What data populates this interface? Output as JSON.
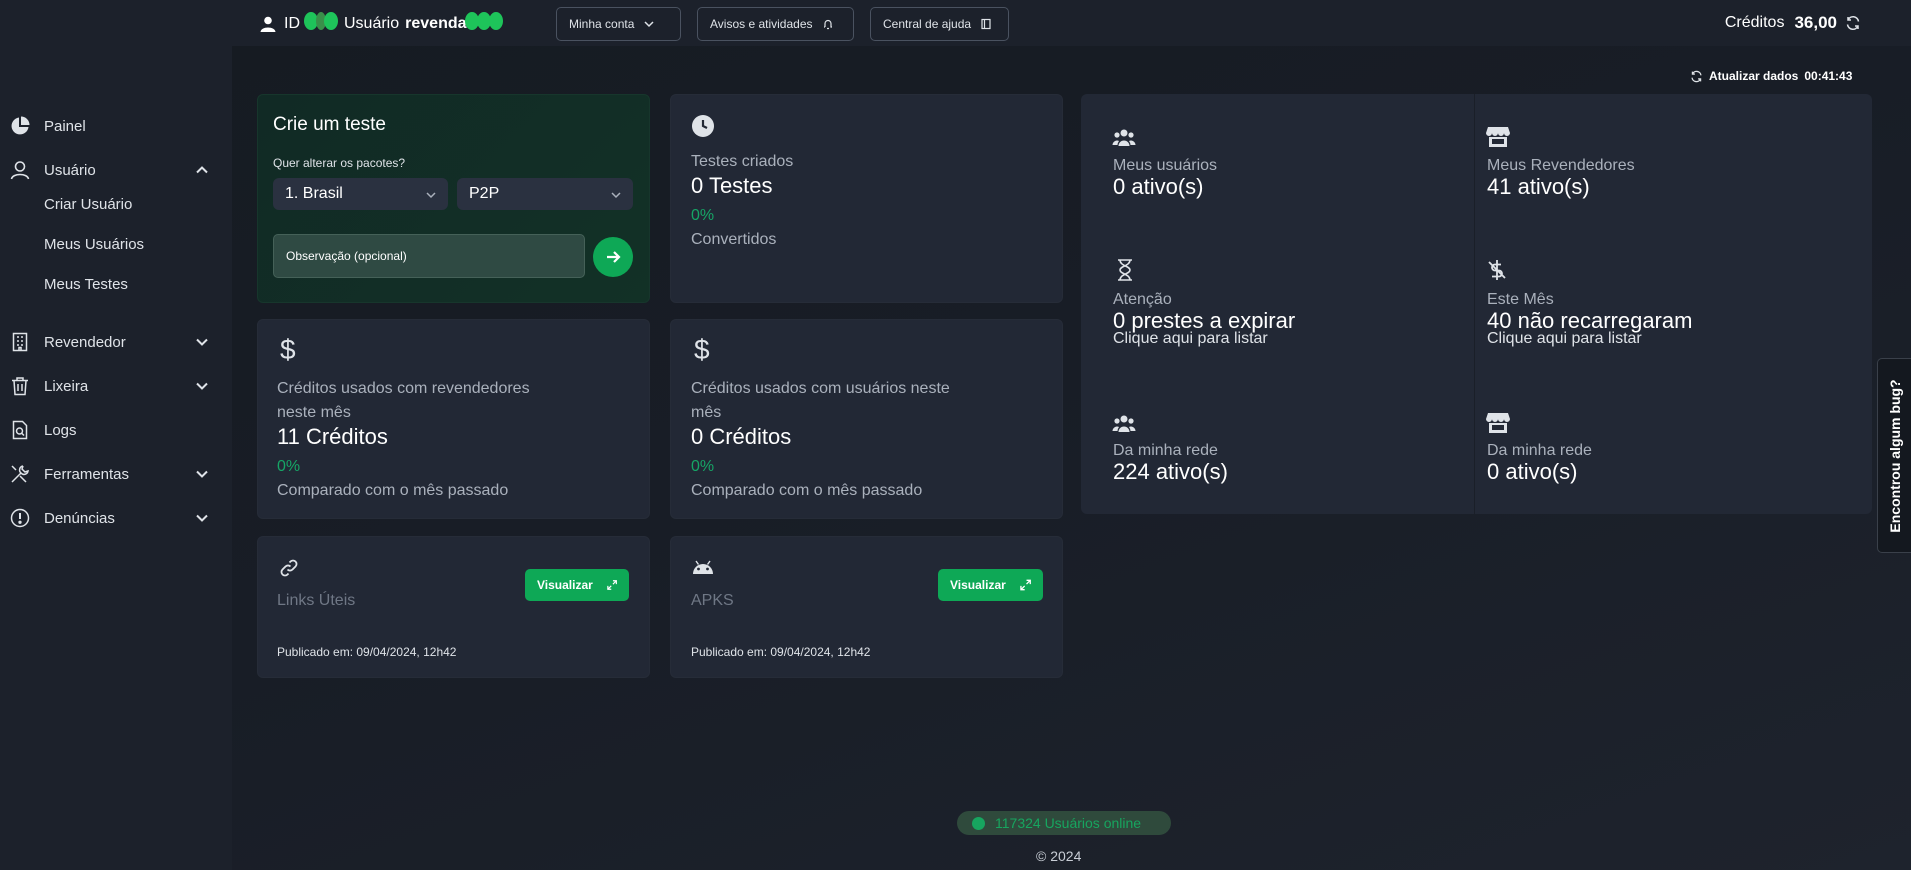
{
  "header": {
    "id_label": "ID",
    "user_label": "Usuário",
    "user_name": "revenda",
    "my_account": "Minha conta",
    "notices": "Avisos e atividades",
    "help_center": "Central de ajuda",
    "credits_label": "Créditos",
    "credits_value": "36,00"
  },
  "sidebar": {
    "panel": "Painel",
    "user": "Usuário",
    "create_user": "Criar Usuário",
    "my_users": "Meus Usuários",
    "my_tests": "Meus Testes",
    "reseller": "Revendedor",
    "trash": "Lixeira",
    "logs": "Logs",
    "tools": "Ferramentas",
    "reports": "Denúncias"
  },
  "refresh": {
    "label": "Atualizar dados",
    "time": "00:41:43"
  },
  "create_test": {
    "title": "Crie um teste",
    "question": "Quer alterar os pacotes?",
    "package": "1. Brasil",
    "type": "P2P",
    "observation_placeholder": "Observação (opcional)"
  },
  "tests_created": {
    "label": "Testes criados",
    "value": "0 Testes",
    "percent": "0%",
    "sub": "Convertidos"
  },
  "credits_resellers": {
    "label_line1": "Créditos usados com revendedores",
    "label_line2": "neste mês",
    "value": "11 Créditos",
    "percent": "0%",
    "sub": "Comparado com o mês passado"
  },
  "credits_users": {
    "label_line1": "Créditos usados com usuários neste",
    "label_line2": "mês",
    "value": "0 Créditos",
    "percent": "0%",
    "sub": "Comparado com o mês passado"
  },
  "links": {
    "title": "Links Úteis",
    "button": "Visualizar",
    "published": "Publicado em: 09/04/2024, 12h42"
  },
  "apks": {
    "title": "APKS",
    "button": "Visualizar",
    "published": "Publicado em: 09/04/2024, 12h42"
  },
  "stats": {
    "my_users": {
      "label": "Meus usuários",
      "value": "0 ativo(s)"
    },
    "my_resellers": {
      "label": "Meus Revendedores",
      "value": "41 ativo(s)"
    },
    "attention": {
      "label": "Atenção",
      "value": "0 prestes a expirar",
      "link": "Clique aqui para listar"
    },
    "this_month": {
      "label": "Este Mês",
      "value": "40 não recarregaram",
      "link": "Clique aqui para listar"
    },
    "network_users": {
      "label": "Da minha rede",
      "value": "224 ativo(s)"
    },
    "network_resellers": {
      "label": "Da minha rede",
      "value": "0 ativo(s)"
    }
  },
  "bug_tab": "Encontrou algum bug?",
  "footer": {
    "online": "117324 Usuários online",
    "copyright": "© 2024"
  },
  "colors": {
    "accent": "#0ea856",
    "percent": "#16a566",
    "card": "#222835",
    "sidebar": "#1c212b"
  }
}
